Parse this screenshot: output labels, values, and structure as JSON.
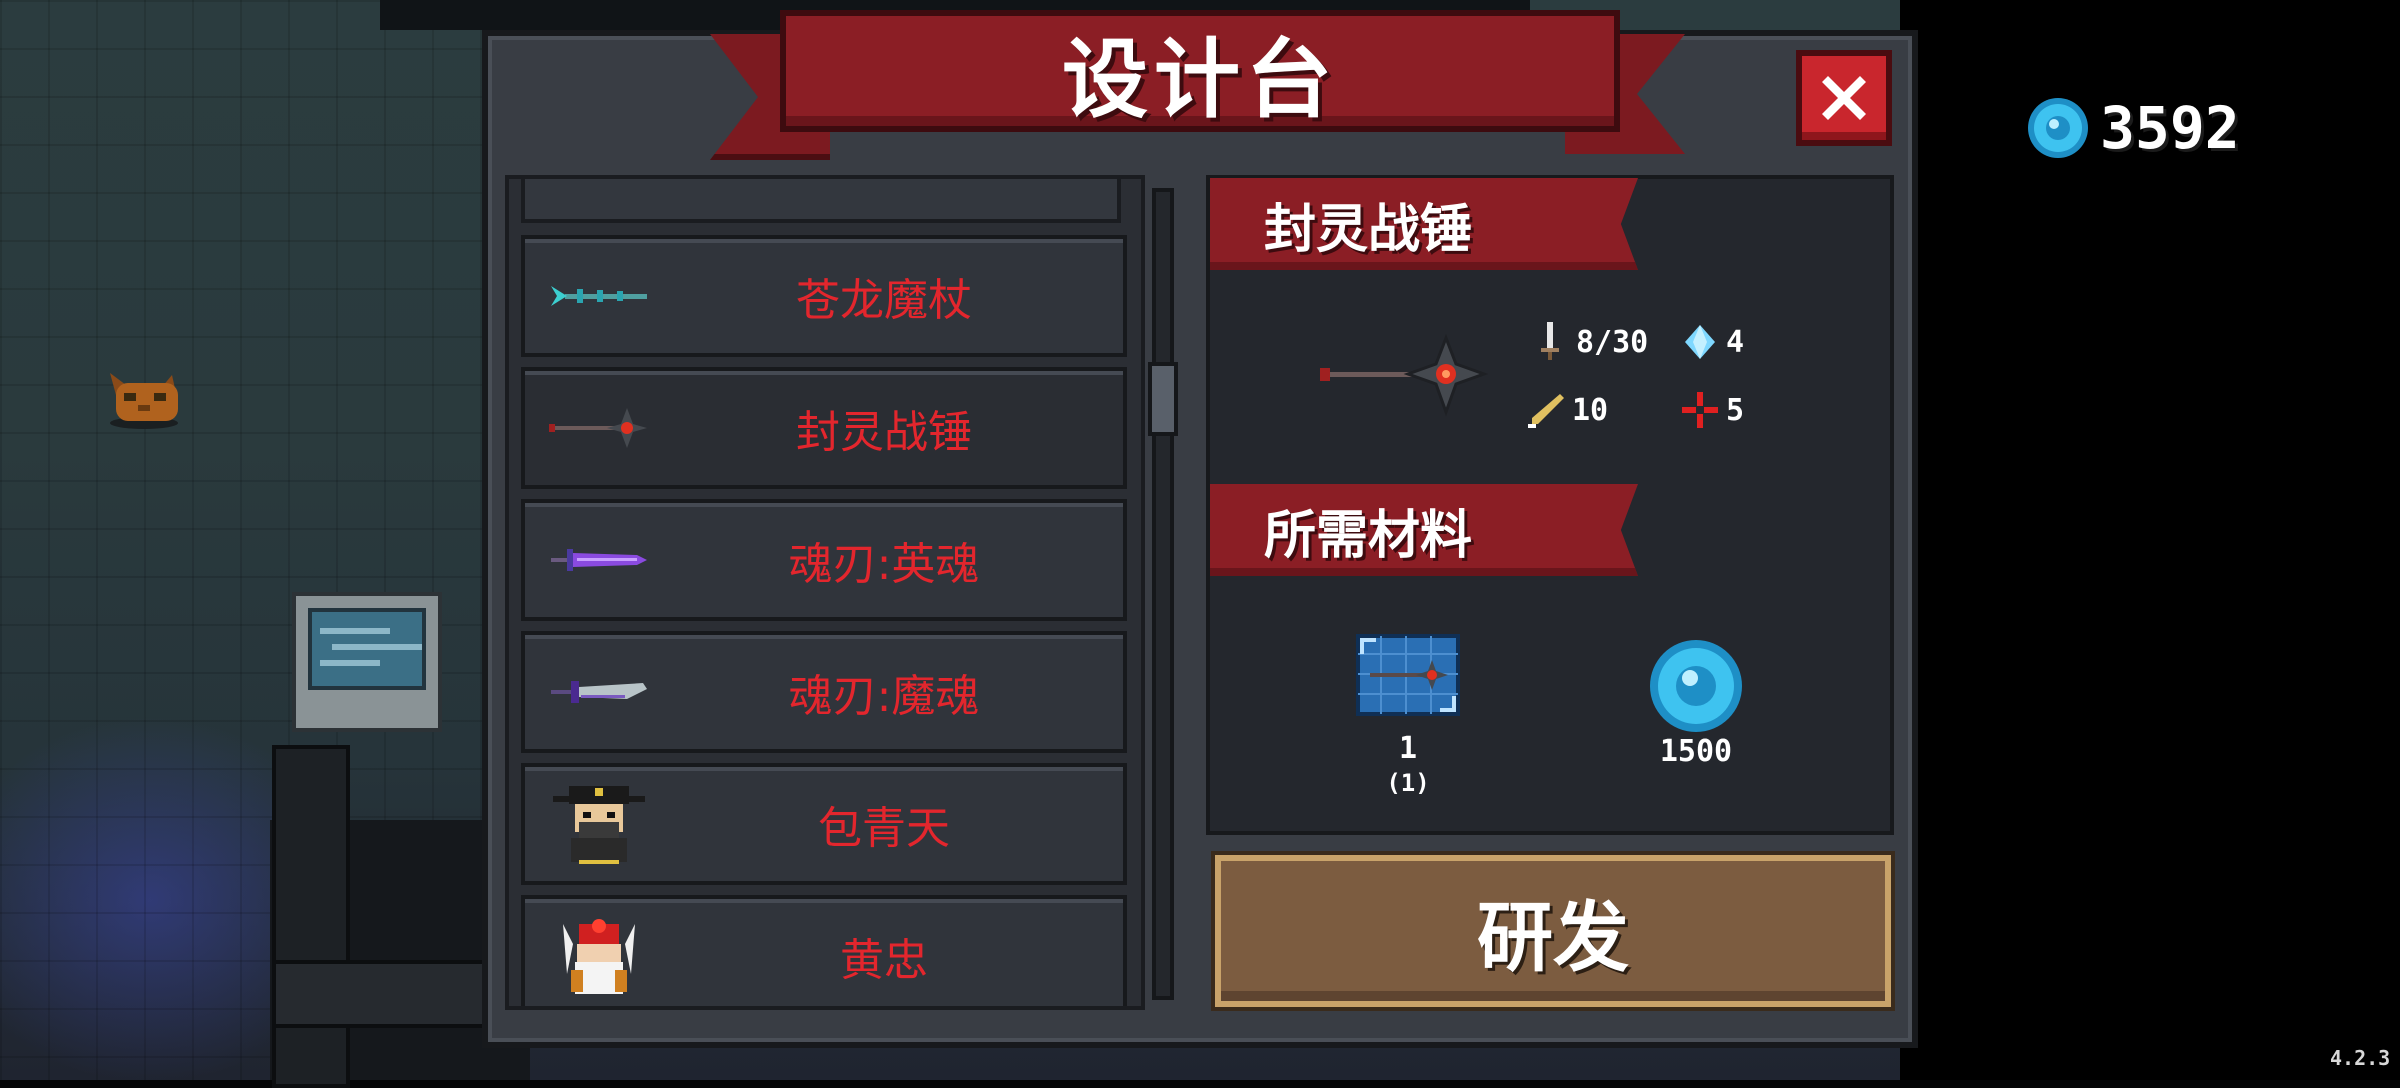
{
  "dialog": {
    "title": "设计台",
    "close_icon": "close-x-icon"
  },
  "currency": {
    "icon": "gem-icon",
    "amount": "3592"
  },
  "version": "4.2.3",
  "recipe_list": [
    {
      "name": "苍龙魔杖",
      "icon": "dragon-staff-icon"
    },
    {
      "name": "封灵战锤",
      "icon": "spiked-mace-icon",
      "selected": true
    },
    {
      "name": "魂刃:英魂",
      "icon": "purple-sword-icon"
    },
    {
      "name": "魂刃:魔魂",
      "icon": "purple-blade-icon"
    },
    {
      "name": "包青天",
      "icon": "judge-character-icon"
    },
    {
      "name": "黄忠",
      "icon": "general-character-icon"
    }
  ],
  "detail": {
    "item_name": "封灵战锤",
    "item_icon": "spiked-mace-icon",
    "stats": {
      "damage": "8/30",
      "energy": "4",
      "accuracy": "10",
      "critical": "5"
    },
    "materials_title": "所需材料",
    "materials": [
      {
        "icon": "blueprint-icon",
        "count": "1",
        "owned": "(1)"
      },
      {
        "icon": "gem-icon",
        "count": "1500"
      }
    ]
  },
  "research_button": "研发",
  "colors": {
    "title_red": "#8b1e25",
    "list_text_red": "#e3262d",
    "panel": "#393d44",
    "button_brown": "#7c5c40",
    "gem_blue": "#3ec3f0"
  }
}
